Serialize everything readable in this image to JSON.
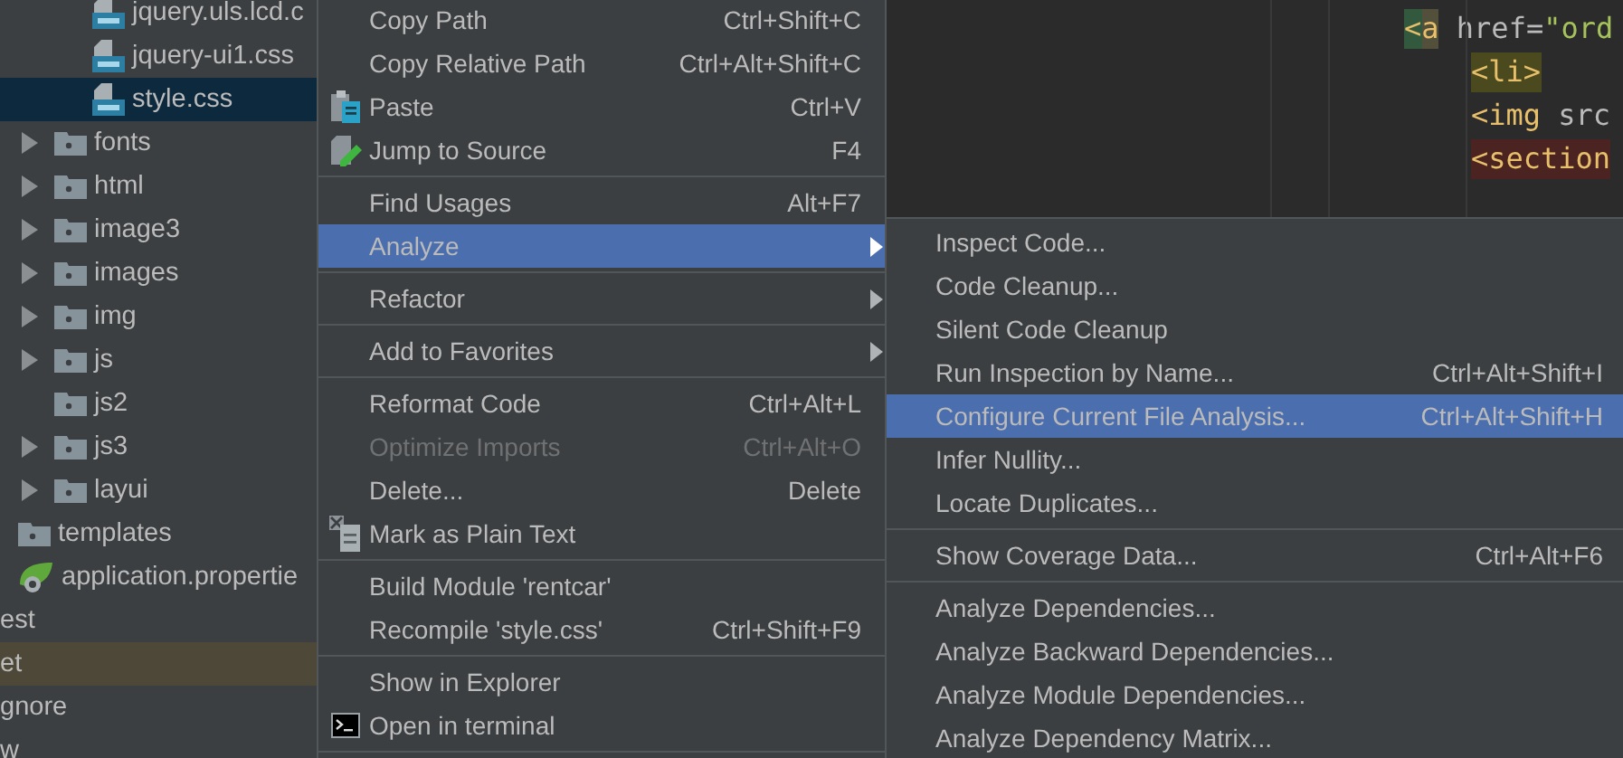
{
  "project_tree": [
    {
      "children": [
        {
          "children": [
            {
              "children": [
                {
                  "label": "jquery.uls.lcd.c",
                  "selected": false,
                  "kind": "css-file"
                },
                {
                  "label": "jquery-ui1.css",
                  "selected": false,
                  "kind": "css-file"
                },
                {
                  "label": "style.css",
                  "selected": true,
                  "kind": "css-file"
                }
              ]
            },
            {
              "label": "fonts",
              "selected": false,
              "kind": "folder",
              "expanded": false
            },
            {
              "label": "html",
              "selected": false,
              "kind": "folder",
              "expanded": false
            },
            {
              "label": "image3",
              "selected": false,
              "kind": "folder",
              "expanded": false
            },
            {
              "label": "images",
              "selected": false,
              "kind": "folder",
              "expanded": false
            },
            {
              "label": "img",
              "selected": false,
              "kind": "folder",
              "expanded": false
            },
            {
              "label": "js",
              "selected": false,
              "kind": "folder",
              "expanded": false
            },
            {
              "label": "js2",
              "selected": false,
              "kind": "folder"
            },
            {
              "label": "js3",
              "selected": false,
              "kind": "folder",
              "expanded": false
            },
            {
              "label": "layui",
              "selected": false,
              "kind": "folder",
              "expanded": false
            }
          ]
        },
        {
          "label": "templates",
          "selected": false,
          "kind": "folder"
        },
        {
          "label": "application.propertie",
          "selected": false,
          "kind": "properties"
        }
      ]
    },
    {
      "label": "est",
      "selected": false
    },
    {
      "label": "et",
      "selected": false,
      "highlighted": true
    },
    {
      "label": "gnore",
      "selected": false
    },
    {
      "label": "w",
      "selected": false
    }
  ],
  "editor": {
    "lines": [
      {
        "tokens": [
          {
            "text": "<",
            "kind": "tag",
            "color": "#32593d"
          },
          {
            "text": "a",
            "kind": "tag",
            "color": "#52503a"
          },
          {
            "text": " href=",
            "kind": "attr"
          },
          {
            "text": "\"ord",
            "kind": "string"
          }
        ],
        "children": [
          {
            "tokens": [
              {
                "text": "<li>",
                "kind": "tag",
                "color": "#4a4a1e"
              }
            ]
          },
          {
            "tokens": [
              {
                "text": "<img",
                "kind": "tag"
              },
              {
                "text": " src",
                "kind": "attr"
              }
            ]
          },
          {
            "tokens": [
              {
                "text": "<section",
                "kind": "tag",
                "color": "#4b2422"
              }
            ]
          }
        ]
      }
    ]
  },
  "context_menu": {
    "items": [
      {
        "kind": "item",
        "label": "Copy Path",
        "shortcut": "Ctrl+Shift+C",
        "selected": false,
        "disabled": false,
        "submenu": false
      },
      {
        "kind": "item",
        "label": "Copy Relative Path",
        "shortcut": "Ctrl+Alt+Shift+C",
        "selected": false,
        "disabled": false,
        "submenu": false
      },
      {
        "kind": "item",
        "label": "Paste",
        "shortcut": "Ctrl+V",
        "selected": false,
        "disabled": false,
        "submenu": false
      },
      {
        "kind": "item",
        "label": "Jump to Source",
        "shortcut": "F4",
        "selected": false,
        "disabled": false,
        "submenu": false
      },
      {
        "kind": "separator"
      },
      {
        "kind": "item",
        "label": "Find Usages",
        "shortcut": "Alt+F7",
        "selected": false,
        "disabled": false,
        "submenu": false
      },
      {
        "kind": "item",
        "label": "Analyze",
        "selected": true,
        "disabled": false,
        "submenu": true
      },
      {
        "kind": "separator"
      },
      {
        "kind": "item",
        "label": "Refactor",
        "selected": false,
        "disabled": false,
        "submenu": true
      },
      {
        "kind": "separator"
      },
      {
        "kind": "item",
        "label": "Add to Favorites",
        "selected": false,
        "disabled": false,
        "submenu": true
      },
      {
        "kind": "separator"
      },
      {
        "kind": "item",
        "label": "Reformat Code",
        "shortcut": "Ctrl+Alt+L",
        "selected": false,
        "disabled": false,
        "submenu": false
      },
      {
        "kind": "item",
        "label": "Optimize Imports",
        "shortcut": "Ctrl+Alt+O",
        "selected": false,
        "disabled": true,
        "submenu": false
      },
      {
        "kind": "item",
        "label": "Delete...",
        "shortcut": "Delete",
        "selected": false,
        "disabled": false,
        "submenu": false
      },
      {
        "kind": "item",
        "label": "Mark as Plain Text",
        "selected": false,
        "disabled": false,
        "submenu": false
      },
      {
        "kind": "separator"
      },
      {
        "kind": "item",
        "label": "Build Module 'rentcar'",
        "selected": false,
        "disabled": false,
        "submenu": false
      },
      {
        "kind": "item",
        "label": "Recompile 'style.css'",
        "shortcut": "Ctrl+Shift+F9",
        "selected": false,
        "disabled": false,
        "submenu": false
      },
      {
        "kind": "separator"
      },
      {
        "kind": "item",
        "label": "Show in Explorer",
        "selected": false,
        "disabled": false,
        "submenu": false
      },
      {
        "kind": "item",
        "label": "Open in terminal",
        "selected": false,
        "disabled": false,
        "submenu": false
      },
      {
        "kind": "separator"
      }
    ]
  },
  "analyze_submenu": {
    "items": [
      {
        "kind": "item",
        "label": "Inspect Code...",
        "selected": false
      },
      {
        "kind": "item",
        "label": "Code Cleanup...",
        "selected": false
      },
      {
        "kind": "item",
        "label": "Silent Code Cleanup",
        "selected": false
      },
      {
        "kind": "item",
        "label": "Run Inspection by Name...",
        "shortcut": "Ctrl+Alt+Shift+I",
        "selected": false
      },
      {
        "kind": "item",
        "label": "Configure Current File Analysis...",
        "shortcut": "Ctrl+Alt+Shift+H",
        "selected": true
      },
      {
        "kind": "item",
        "label": "Infer Nullity...",
        "selected": false
      },
      {
        "kind": "item",
        "label": "Locate Duplicates...",
        "selected": false
      },
      {
        "kind": "separator"
      },
      {
        "kind": "item",
        "label": "Show Coverage Data...",
        "shortcut": "Ctrl+Alt+F6",
        "selected": false
      },
      {
        "kind": "separator"
      },
      {
        "kind": "item",
        "label": "Analyze Dependencies...",
        "selected": false
      },
      {
        "kind": "item",
        "label": "Analyze Backward Dependencies...",
        "selected": false
      },
      {
        "kind": "item",
        "label": "Analyze Module Dependencies...",
        "selected": false
      },
      {
        "kind": "item",
        "label": "Analyze Dependency Matrix...",
        "selected": false
      }
    ]
  }
}
